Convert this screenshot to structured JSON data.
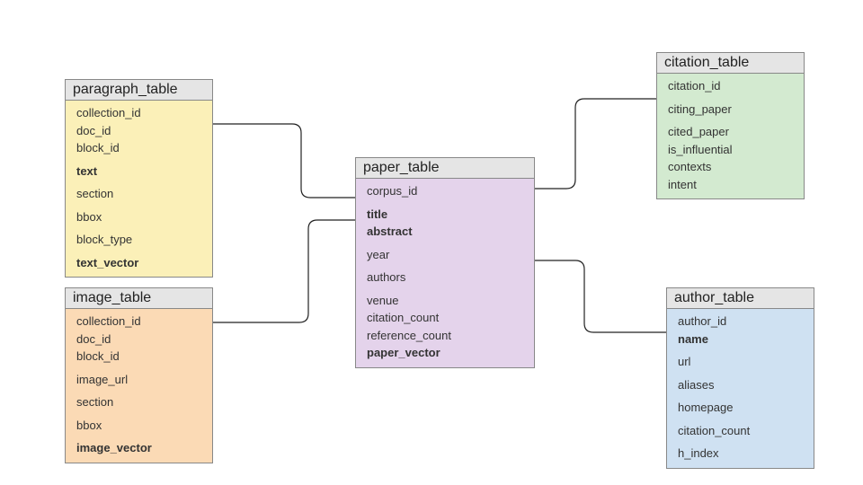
{
  "tables": {
    "paragraph": {
      "title": "paragraph_table",
      "fields": [
        {
          "name": "collection_id",
          "bold": false,
          "spaced": false
        },
        {
          "name": "doc_id",
          "bold": false,
          "spaced": false
        },
        {
          "name": "block_id",
          "bold": false,
          "spaced": false
        },
        {
          "name": "text",
          "bold": true,
          "spaced": true
        },
        {
          "name": "section",
          "bold": false,
          "spaced": true
        },
        {
          "name": "bbox",
          "bold": false,
          "spaced": true
        },
        {
          "name": "block_type",
          "bold": false,
          "spaced": true
        },
        {
          "name": "text_vector",
          "bold": true,
          "spaced": true
        }
      ]
    },
    "image": {
      "title": "image_table",
      "fields": [
        {
          "name": "collection_id",
          "bold": false,
          "spaced": false
        },
        {
          "name": "doc_id",
          "bold": false,
          "spaced": false
        },
        {
          "name": "block_id",
          "bold": false,
          "spaced": false
        },
        {
          "name": "image_url",
          "bold": false,
          "spaced": true
        },
        {
          "name": "section",
          "bold": false,
          "spaced": true
        },
        {
          "name": "bbox",
          "bold": false,
          "spaced": true
        },
        {
          "name": "image_vector",
          "bold": true,
          "spaced": true
        }
      ]
    },
    "paper": {
      "title": "paper_table",
      "fields": [
        {
          "name": "corpus_id",
          "bold": false,
          "spaced": false
        },
        {
          "name": "title",
          "bold": true,
          "spaced": true
        },
        {
          "name": "abstract",
          "bold": true,
          "spaced": false
        },
        {
          "name": "year",
          "bold": false,
          "spaced": true
        },
        {
          "name": "authors",
          "bold": false,
          "spaced": true
        },
        {
          "name": "venue",
          "bold": false,
          "spaced": true
        },
        {
          "name": "citation_count",
          "bold": false,
          "spaced": false
        },
        {
          "name": "reference_count",
          "bold": false,
          "spaced": false
        },
        {
          "name": "paper_vector",
          "bold": true,
          "spaced": false
        }
      ]
    },
    "citation": {
      "title": "citation_table",
      "fields": [
        {
          "name": "citation_id",
          "bold": false,
          "spaced": false
        },
        {
          "name": "citing_paper",
          "bold": false,
          "spaced": true
        },
        {
          "name": "cited_paper",
          "bold": false,
          "spaced": true
        },
        {
          "name": "is_influential",
          "bold": false,
          "spaced": false
        },
        {
          "name": "contexts",
          "bold": false,
          "spaced": false
        },
        {
          "name": "intent",
          "bold": false,
          "spaced": false
        }
      ]
    },
    "author": {
      "title": "author_table",
      "fields": [
        {
          "name": "author_id",
          "bold": false,
          "spaced": false
        },
        {
          "name": "name",
          "bold": true,
          "spaced": false
        },
        {
          "name": "url",
          "bold": false,
          "spaced": true
        },
        {
          "name": "aliases",
          "bold": false,
          "spaced": true
        },
        {
          "name": "homepage",
          "bold": false,
          "spaced": true
        },
        {
          "name": "citation_count",
          "bold": false,
          "spaced": true
        },
        {
          "name": "h_index",
          "bold": false,
          "spaced": true
        }
      ]
    }
  },
  "colors": {
    "paragraph_bg": "#fbf0b8",
    "image_bg": "#fbdab5",
    "paper_bg": "#e4d3eb",
    "citation_bg": "#d3ead0",
    "author_bg": "#cfe1f2",
    "header_bg": "#e5e5e5"
  }
}
